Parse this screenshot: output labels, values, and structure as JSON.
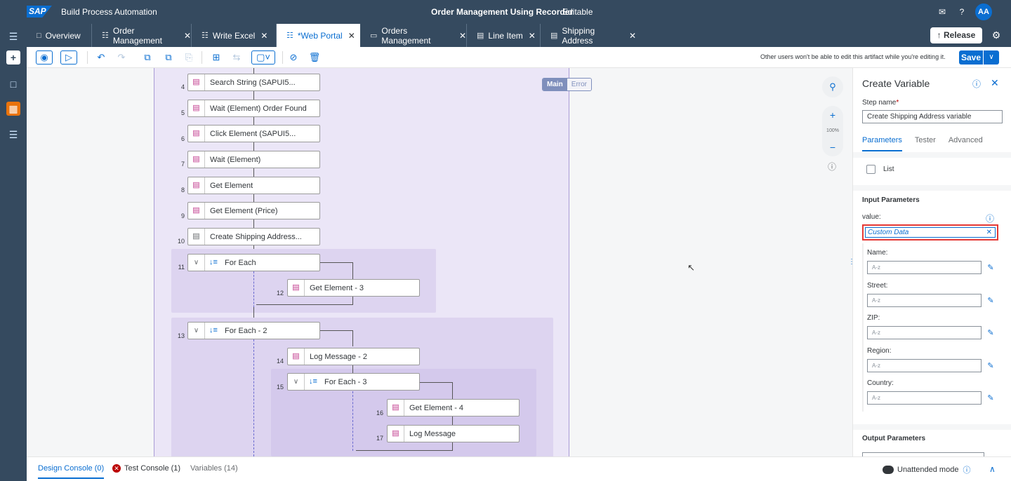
{
  "shell": {
    "logo": "SAP",
    "app_name": "Build Process Automation",
    "project_title": "Order Management Using Recorder",
    "project_state": "Editable",
    "avatar": "AA",
    "icons": [
      "feedback-icon",
      "help-icon"
    ]
  },
  "tabs": [
    {
      "label": "Overview",
      "icon": "overview-icon",
      "closable": false
    },
    {
      "label": "Order Management",
      "icon": "process-icon",
      "closable": true
    },
    {
      "label": "Write Excel",
      "icon": "process-icon",
      "closable": true
    },
    {
      "label": "*Web Portal",
      "icon": "process-icon",
      "closable": true,
      "active": true
    },
    {
      "label": "Orders Management",
      "icon": "screen-icon",
      "closable": true
    },
    {
      "label": "Line Item",
      "icon": "data-type-icon",
      "closable": true
    },
    {
      "label": "Shipping Address",
      "icon": "data-type-icon",
      "closable": true
    }
  ],
  "header_actions": {
    "release_label": "Release"
  },
  "toolbar": {
    "message": "Other users won't be able to edit this artifact while you're editing it.",
    "save_label": "Save"
  },
  "canvas": {
    "view_main": "Main",
    "view_error": "Error",
    "zoom_level": "100%",
    "steps": [
      {
        "num": "4",
        "label": "Search String (SAPUI5..."
      },
      {
        "num": "5",
        "label": "Wait (Element) Order Found"
      },
      {
        "num": "6",
        "label": "Click Element (SAPUI5..."
      },
      {
        "num": "7",
        "label": "Wait (Element)"
      },
      {
        "num": "8",
        "label": "Get Element"
      },
      {
        "num": "9",
        "label": "Get Element (Price)"
      },
      {
        "num": "10",
        "label": "Create Shipping Address..."
      },
      {
        "num": "11",
        "label": "For Each"
      },
      {
        "num": "12",
        "label": "Get Element - 3"
      },
      {
        "num": "13",
        "label": "For Each - 2"
      },
      {
        "num": "14",
        "label": "Log Message - 2"
      },
      {
        "num": "15",
        "label": "For Each - 3"
      },
      {
        "num": "16",
        "label": "Get Element - 4"
      },
      {
        "num": "17",
        "label": "Log Message"
      }
    ]
  },
  "panel": {
    "title": "Create Variable",
    "step_name_label": "Step name",
    "required_mark": "*",
    "step_name_value": "Create Shipping Address variable",
    "tabs": [
      "Parameters",
      "Tester",
      "Advanced"
    ],
    "list_label": "List",
    "input_params_title": "Input Parameters",
    "value_label": "value:",
    "value": "Custom Data",
    "fields": [
      {
        "label": "Name:",
        "placeholder": "A-z"
      },
      {
        "label": "Street:",
        "placeholder": "A-z"
      },
      {
        "label": "ZIP:",
        "placeholder": "A-z"
      },
      {
        "label": "Region:",
        "placeholder": "A-z"
      },
      {
        "label": "Country:",
        "placeholder": "A-z"
      }
    ],
    "output_params_title": "Output Parameters"
  },
  "bottom": {
    "design_console": "Design Console (0)",
    "test_console": "Test Console (1)",
    "variables": "Variables (14)",
    "mode": "Unattended mode"
  },
  "colors": {
    "shell": "#354a5f",
    "accent": "#0a6ed1",
    "highlight_border": "#e53935",
    "flow_bg": "#ebe6f7"
  }
}
